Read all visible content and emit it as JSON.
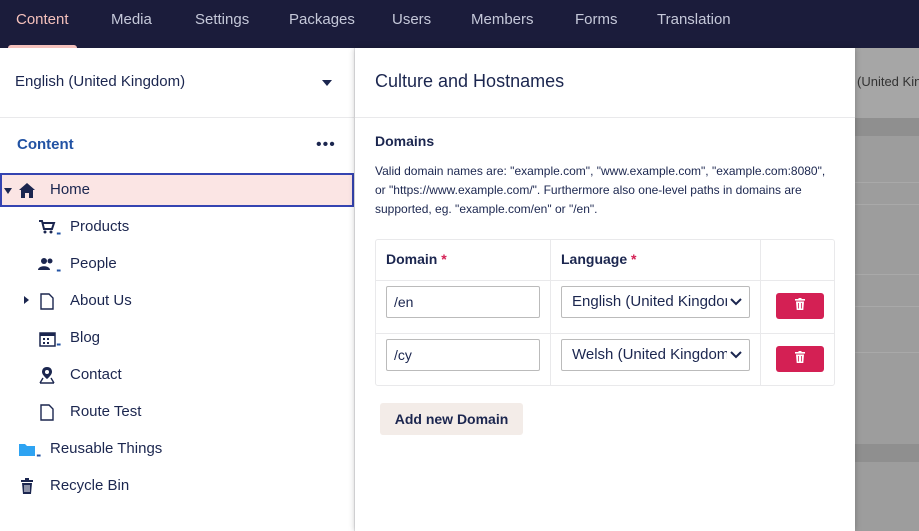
{
  "topnav": {
    "tabs": [
      {
        "label": "Content",
        "active": true
      },
      {
        "label": "Media"
      },
      {
        "label": "Settings"
      },
      {
        "label": "Packages"
      },
      {
        "label": "Users"
      },
      {
        "label": "Members"
      },
      {
        "label": "Forms"
      },
      {
        "label": "Translation"
      }
    ]
  },
  "sidebar": {
    "language": "English (United Kingdom)",
    "section_title": "Content",
    "more_label": "•••",
    "tree": [
      {
        "label": "Home",
        "icon": "home-icon",
        "expanded": true,
        "selected": true
      },
      {
        "label": "Products",
        "icon": "shopping-cart-icon"
      },
      {
        "label": "People",
        "icon": "people-icon"
      },
      {
        "label": "About Us",
        "icon": "document-icon",
        "has_children": true
      },
      {
        "label": "Blog",
        "icon": "calendar-icon"
      },
      {
        "label": "Contact",
        "icon": "map-pin-icon"
      },
      {
        "label": "Route Test",
        "icon": "document-icon"
      },
      {
        "label": "Reusable Things",
        "icon": "folder-icon"
      },
      {
        "label": "Recycle Bin",
        "icon": "trash-icon"
      }
    ]
  },
  "background": {
    "truncated_text": "(United Kin"
  },
  "dialog": {
    "title": "Culture and Hostnames",
    "section_title": "Domains",
    "description": "Valid domain names are: \"example.com\", \"www.example.com\", \"example.com:8080\", or \"https://www.example.com/\". Furthermore also one-level paths in domains are supported, eg. \"example.com/en\" or \"/en\".",
    "table": {
      "domain_header": "Domain",
      "language_header": "Language",
      "required_mark": "*",
      "rows": [
        {
          "domain": "/en",
          "language": "English (United Kingdom)"
        },
        {
          "domain": "/cy",
          "language": "Welsh (United Kingdom)"
        }
      ]
    },
    "add_button": "Add new Domain"
  },
  "colors": {
    "nav_bg": "#1b1c3b",
    "accent": "#f5c1bc",
    "link": "#2152a3",
    "danger": "#d42054",
    "selected_bg": "#fbe5e4",
    "selected_border": "#3544b1"
  }
}
